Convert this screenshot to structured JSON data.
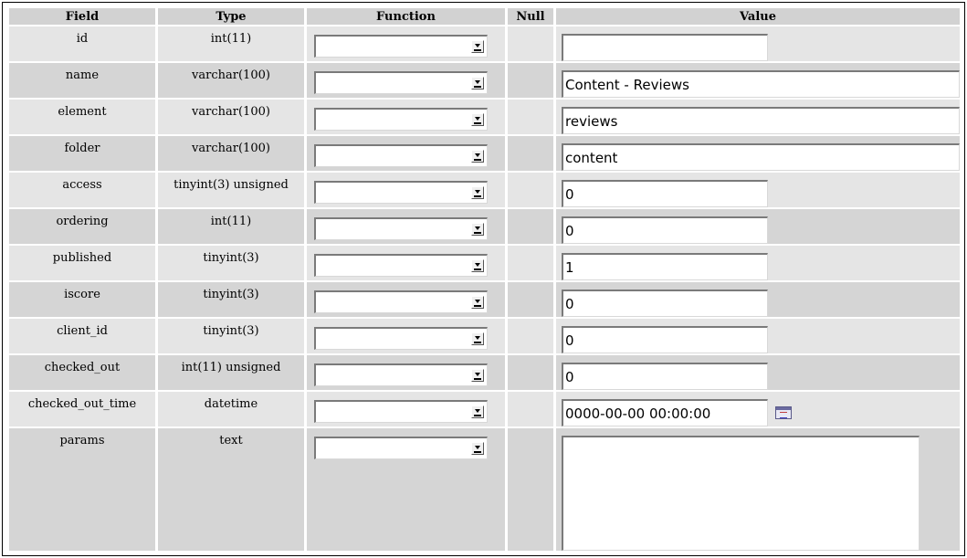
{
  "headers": {
    "field": "Field",
    "type": "Type",
    "function": "Function",
    "null": "Null",
    "value": "Value"
  },
  "rows": [
    {
      "field": "id",
      "type": "int(11)",
      "function": "",
      "value": "",
      "input": "short"
    },
    {
      "field": "name",
      "type": "varchar(100)",
      "function": "",
      "value": "Content - Reviews",
      "input": "long"
    },
    {
      "field": "element",
      "type": "varchar(100)",
      "function": "",
      "value": "reviews",
      "input": "long"
    },
    {
      "field": "folder",
      "type": "varchar(100)",
      "function": "",
      "value": "content",
      "input": "long"
    },
    {
      "field": "access",
      "type": "tinyint(3) unsigned",
      "function": "",
      "value": "0",
      "input": "short"
    },
    {
      "field": "ordering",
      "type": "int(11)",
      "function": "",
      "value": "0",
      "input": "short"
    },
    {
      "field": "published",
      "type": "tinyint(3)",
      "function": "",
      "value": "1",
      "input": "short"
    },
    {
      "field": "iscore",
      "type": "tinyint(3)",
      "function": "",
      "value": "0",
      "input": "short"
    },
    {
      "field": "client_id",
      "type": "tinyint(3)",
      "function": "",
      "value": "0",
      "input": "short"
    },
    {
      "field": "checked_out",
      "type": "int(11) unsigned",
      "function": "",
      "value": "0",
      "input": "short"
    },
    {
      "field": "checked_out_time",
      "type": "datetime",
      "function": "",
      "value": "0000-00-00 00:00:00",
      "input": "date"
    },
    {
      "field": "params",
      "type": "text",
      "function": "",
      "value": "",
      "input": "textarea"
    }
  ],
  "icons": {
    "calendar": "calendar-icon",
    "dropdown": "chevron-down-icon"
  },
  "colors": {
    "header_bg": "#d2d2d2",
    "row_light": "#e5e5e5",
    "row_dark": "#d5d5d5"
  }
}
